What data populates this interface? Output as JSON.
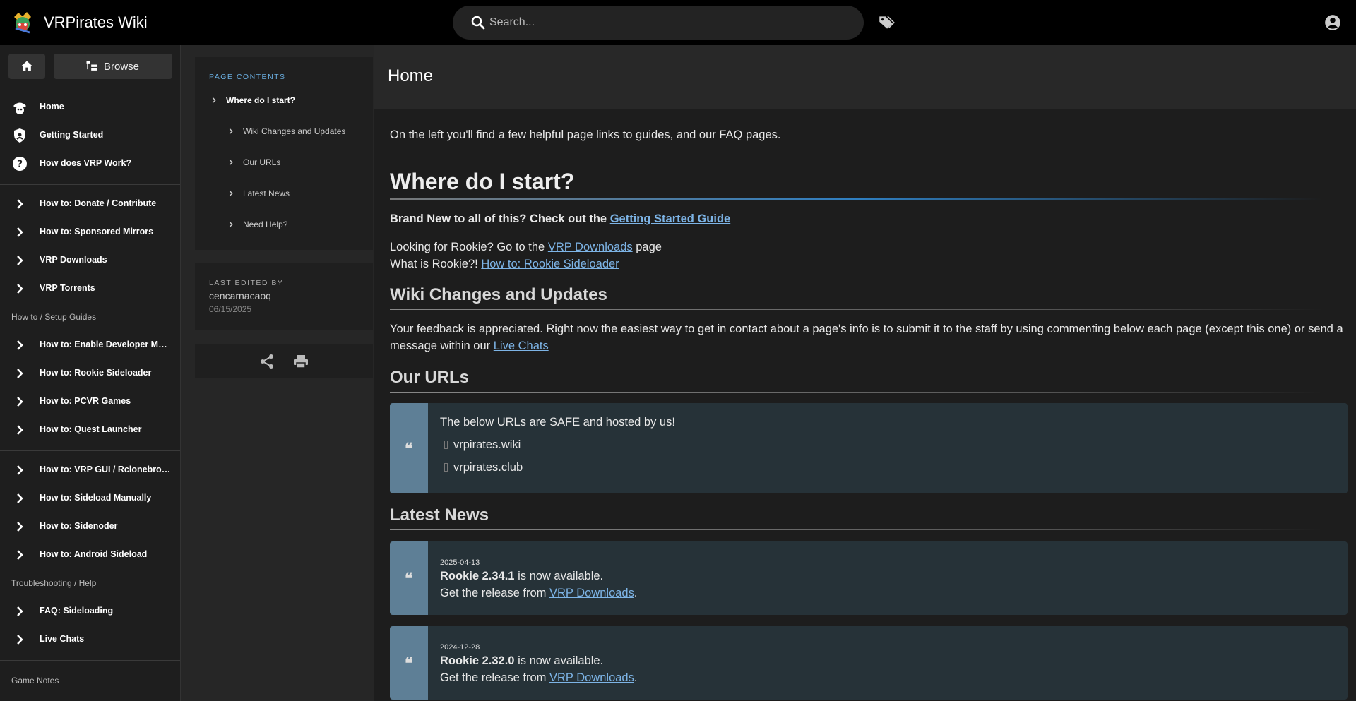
{
  "topbar": {
    "site_title": "VRPirates Wiki",
    "search_placeholder": "Search..."
  },
  "nav": {
    "browse_label": "Browse",
    "items": [
      {
        "label": "Home",
        "icon": "pirate-icon"
      },
      {
        "label": "Getting Started",
        "icon": "shield-icon"
      },
      {
        "label": "How does VRP Work?",
        "icon": "help-icon"
      },
      {
        "label": "How to: Donate / Contribute",
        "icon": "chevron-right-icon"
      },
      {
        "label": "How to: Sponsored Mirrors",
        "icon": "chevron-right-icon"
      },
      {
        "label": "VRP Downloads",
        "icon": "chevron-right-icon"
      },
      {
        "label": "VRP Torrents",
        "icon": "chevron-right-icon"
      },
      {
        "label": "How to: Enable Developer Mode",
        "icon": "chevron-right-icon"
      },
      {
        "label": "How to: Rookie Sideloader",
        "icon": "chevron-right-icon"
      },
      {
        "label": "How to: PCVR Games",
        "icon": "chevron-right-icon"
      },
      {
        "label": "How to: Quest Launcher",
        "icon": "chevron-right-icon"
      },
      {
        "label": "How to: VRP GUI / Rclonebrowser",
        "icon": "chevron-right-icon"
      },
      {
        "label": "How to: Sideload Manually",
        "icon": "chevron-right-icon"
      },
      {
        "label": "How to: Sidenoder",
        "icon": "chevron-right-icon"
      },
      {
        "label": "How to: Android Sideload",
        "icon": "chevron-right-icon"
      },
      {
        "label": "FAQ: Sideloading",
        "icon": "chevron-right-icon"
      },
      {
        "label": "Live Chats",
        "icon": "chevron-right-icon"
      }
    ],
    "headers": [
      "How to / Setup Guides",
      "Troubleshooting / Help",
      "Game Notes"
    ]
  },
  "toc": {
    "title": "PAGE CONTENTS",
    "items": [
      "Where do I start?",
      "Wiki Changes and Updates",
      "Our URLs",
      "Latest News",
      "Need Help?"
    ]
  },
  "meta": {
    "title": "LAST EDITED BY",
    "user": "cencarnacaoq",
    "date": "06/15/2025"
  },
  "page": {
    "title": "Home",
    "intro": "On the left you'll find a few helpful page links to guides, and our FAQ pages.",
    "h_start": "Where do I start?",
    "brand_new_prefix": "Brand New to all of this? Check out the ",
    "brand_new_link": "Getting Started Guide",
    "rookie_prefix": "Looking for Rookie? Go to the ",
    "rookie_link": "VRP Downloads",
    "rookie_suffix": " page",
    "what_prefix": "What is Rookie?! ",
    "what_link": "How to: Rookie Sideloader",
    "h_changes": "Wiki Changes and Updates",
    "feedback_text": "Your feedback is appreciated. Right now the easiest way to get in contact about a page's info is to submit it to the staff by using commenting below each page (except this one) or send a message within our ",
    "feedback_link": "Live Chats",
    "h_urls": "Our URLs",
    "urls_intro": "The below URLs are SAFE and hosted by us!",
    "urls": [
      "vrpirates.wiki",
      "vrpirates.club"
    ],
    "h_news": "Latest News",
    "news": [
      {
        "date": "2025-04-13",
        "version": "Rookie 2.34.1",
        "text": " is now available.",
        "release_prefix": "Get the release from ",
        "release_link": "VRP Downloads",
        "release_suffix": "."
      },
      {
        "date": "2024-12-28",
        "version": "Rookie 2.32.0",
        "text": " is now available.",
        "release_prefix": "Get the release from ",
        "release_link": "VRP Downloads",
        "release_suffix": "."
      }
    ]
  },
  "colors": {
    "accent": "#2f7fc1",
    "link": "#7db4e6",
    "quote_bar": "#5e7f96",
    "quote_bg": "#263238"
  }
}
